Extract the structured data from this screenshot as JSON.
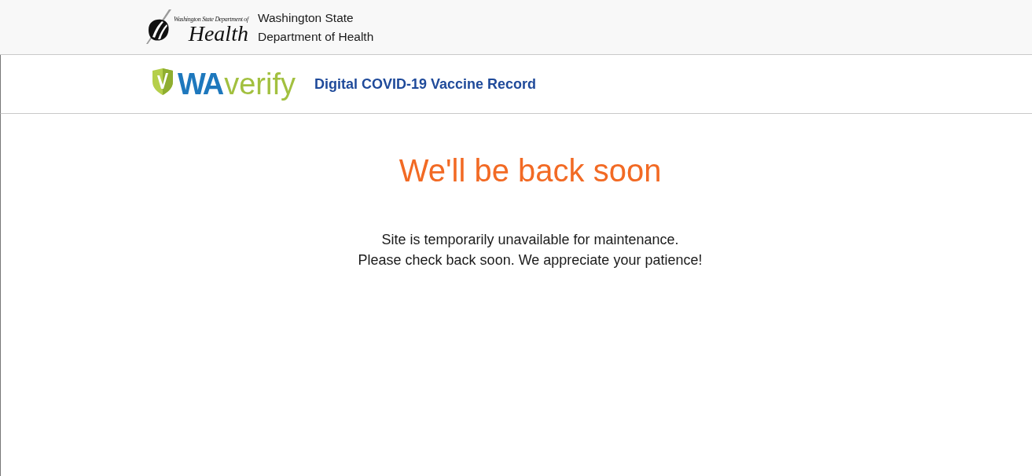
{
  "agency_bar": {
    "logo": {
      "small_text": "Washington State Department of",
      "big_text": "Health"
    },
    "name_lines": [
      "Washington State",
      "Department of Health"
    ]
  },
  "app_bar": {
    "logo": {
      "part_1": "WA",
      "part_2": "verify"
    },
    "title": "Digital COVID-19 Vaccine Record"
  },
  "main": {
    "heading": "We'll be back soon",
    "message_lines": [
      "Site is temporarily unavailable for maintenance.",
      "Please check back soon. We appreciate your patience!"
    ]
  }
}
